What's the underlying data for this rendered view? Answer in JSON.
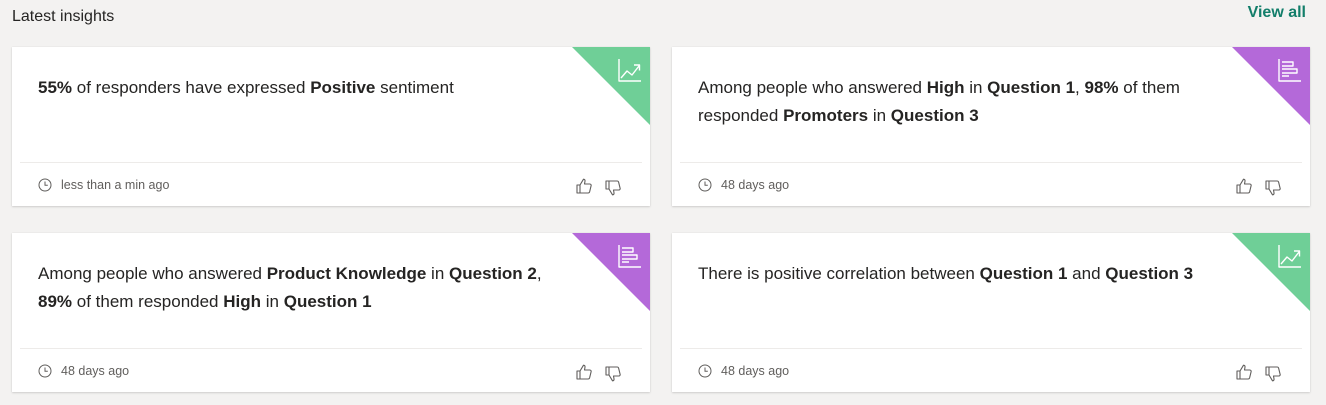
{
  "header": {
    "title": "Latest insights",
    "view_all": "View all"
  },
  "colors": {
    "trend_badge": "#6fcf97",
    "bar_badge": "#b469d9",
    "link": "#127e6a"
  },
  "cards": [
    {
      "badge": "trend",
      "badge_icon": "trend-chart-icon",
      "text": [
        {
          "t": "55%",
          "b": true
        },
        {
          "t": " of responders have expressed ",
          "b": false
        },
        {
          "t": "Positive",
          "b": true
        },
        {
          "t": " sentiment",
          "b": false
        }
      ],
      "time": "less than a min ago"
    },
    {
      "badge": "bar",
      "badge_icon": "bar-chart-icon",
      "text": [
        {
          "t": "Among people who answered ",
          "b": false
        },
        {
          "t": "High",
          "b": true
        },
        {
          "t": " in ",
          "b": false
        },
        {
          "t": "Question 1",
          "b": true
        },
        {
          "t": ", ",
          "b": false
        },
        {
          "t": "98%",
          "b": true
        },
        {
          "t": " of them responded ",
          "b": false
        },
        {
          "t": "Promoters",
          "b": true
        },
        {
          "t": " in ",
          "b": false
        },
        {
          "t": "Question 3",
          "b": true
        }
      ],
      "time": "48 days ago"
    },
    {
      "badge": "bar",
      "badge_icon": "bar-chart-icon",
      "text": [
        {
          "t": "Among people who answered ",
          "b": false
        },
        {
          "t": "Product Knowledge",
          "b": true
        },
        {
          "t": " in ",
          "b": false
        },
        {
          "t": "Question 2",
          "b": true
        },
        {
          "t": ", ",
          "b": false
        },
        {
          "t": "89%",
          "b": true
        },
        {
          "t": " of them responded ",
          "b": false
        },
        {
          "t": "High",
          "b": true
        },
        {
          "t": " in ",
          "b": false
        },
        {
          "t": "Question 1",
          "b": true
        }
      ],
      "time": "48 days ago"
    },
    {
      "badge": "trend",
      "badge_icon": "trend-chart-icon",
      "text": [
        {
          "t": "There is positive correlation between ",
          "b": false
        },
        {
          "t": "Question 1",
          "b": true
        },
        {
          "t": " and ",
          "b": false
        },
        {
          "t": "Question 3",
          "b": true
        }
      ],
      "time": "48 days ago"
    }
  ]
}
